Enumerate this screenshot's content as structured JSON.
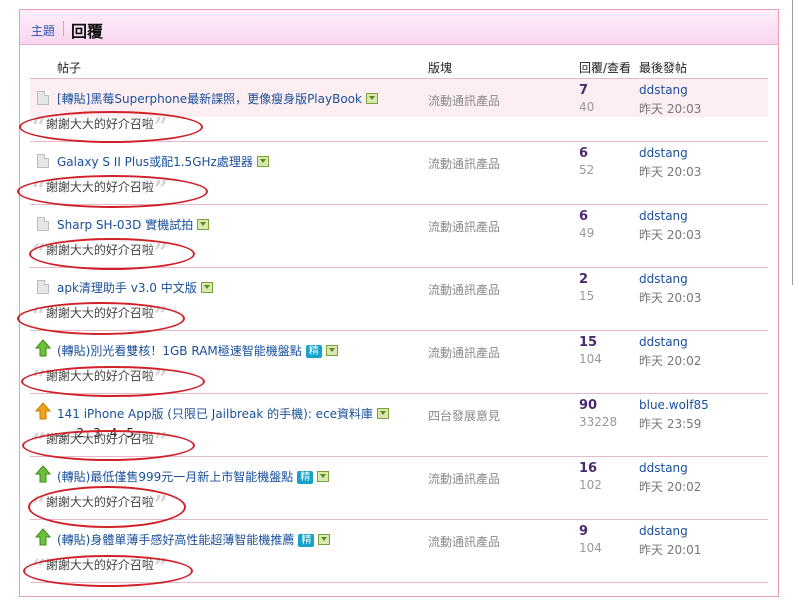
{
  "header": {
    "tab_topics": "主題",
    "tab_replies": "回覆"
  },
  "columns": {
    "post": "帖子",
    "forum": "版塊",
    "replies_views": "回覆/查看",
    "last_post": "最後發帖"
  },
  "quote_text": "謝謝大大的好介召啦",
  "rows": [
    {
      "title": "[轉貼]黑莓Superphone最新諜照，更像瘦身版PlayBook",
      "forum": "流動通訊產品",
      "replies": "7",
      "views": "40",
      "author": "ddstang",
      "time": "昨天 20:03",
      "icon": "file-icon",
      "badge": ""
    },
    {
      "title": "Galaxy S II Plus或配1.5GHz處理器",
      "forum": "流動通訊產品",
      "replies": "6",
      "views": "52",
      "author": "ddstang",
      "time": "昨天 20:03",
      "icon": "file-icon",
      "badge": ""
    },
    {
      "title": "Sharp SH-03D 實機試拍",
      "forum": "流動通訊產品",
      "replies": "6",
      "views": "49",
      "author": "ddstang",
      "time": "昨天 20:03",
      "icon": "file-icon",
      "badge": ""
    },
    {
      "title": "apk清理助手 v3.0 中文版",
      "forum": "流動通訊產品",
      "replies": "2",
      "views": "15",
      "author": "ddstang",
      "time": "昨天 20:03",
      "icon": "file-icon",
      "badge": ""
    },
    {
      "title": "(轉貼)別光看雙核！1GB RAM極速智能機盤點",
      "forum": "流動通訊產品",
      "replies": "15",
      "views": "104",
      "author": "ddstang",
      "time": "昨天 20:02",
      "icon": "up-arrow-icon",
      "badge": "精"
    },
    {
      "title": "141 iPhone App版 (只限已 Jailbreak 的手機): ece資料庫",
      "forum": "四台發展意見",
      "replies": "90",
      "views": "33228",
      "author": "blue.wolf85",
      "time": "昨天 23:59",
      "icon": "hot-arrow-icon",
      "badge": "",
      "pages": [
        "...",
        "2",
        "3",
        "4",
        "5"
      ]
    },
    {
      "title": "(轉貼)最低僅售999元一月新上市智能機盤點",
      "forum": "流動通訊產品",
      "replies": "16",
      "views": "102",
      "author": "ddstang",
      "time": "昨天 20:02",
      "icon": "up-arrow-icon",
      "badge": "精"
    },
    {
      "title": "(轉貼)身體單薄手感好高性能超薄智能機推薦",
      "forum": "流動通訊產品",
      "replies": "9",
      "views": "104",
      "author": "ddstang",
      "time": "昨天 20:01",
      "icon": "up-arrow-icon",
      "badge": "精"
    }
  ],
  "colors": {
    "accent_pink": "#f7d6ef",
    "link_blue": "#1a4f9a",
    "annotation_red": "#d0212a"
  }
}
